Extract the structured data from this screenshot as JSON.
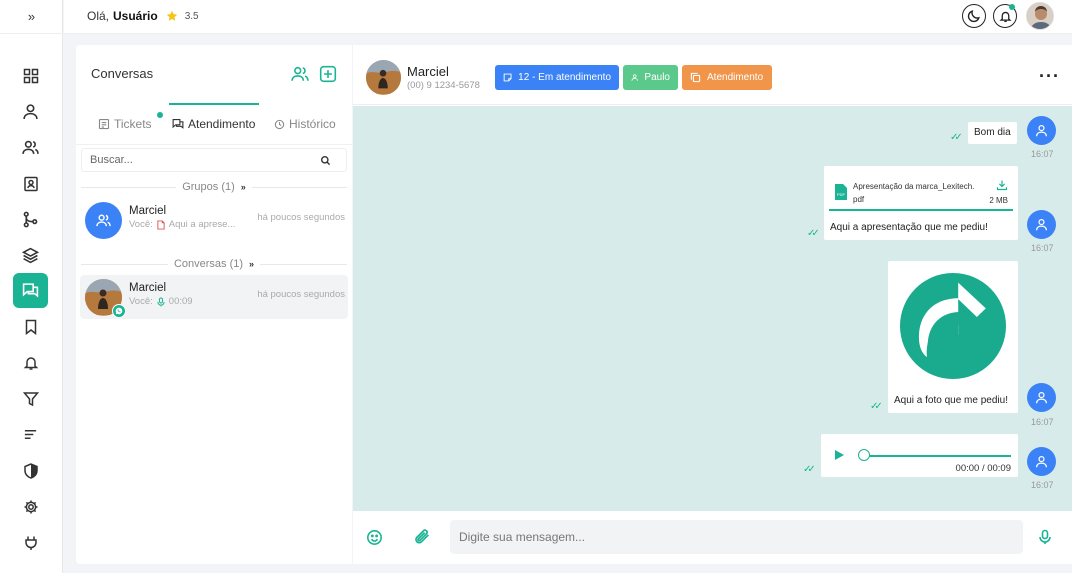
{
  "sidebar": {
    "expand_label": "»",
    "items": [
      {
        "icon": "grid-icon"
      },
      {
        "icon": "user-icon"
      },
      {
        "icon": "users-icon"
      },
      {
        "icon": "contact-card-icon"
      },
      {
        "icon": "git-branch-icon"
      },
      {
        "icon": "layers-icon"
      },
      {
        "icon": "chat-icon",
        "active": true
      },
      {
        "icon": "bookmark-icon"
      },
      {
        "icon": "bell-icon"
      },
      {
        "icon": "filter-icon"
      },
      {
        "icon": "sort-lines-icon"
      },
      {
        "icon": "shield-icon"
      },
      {
        "icon": "gear-icon"
      },
      {
        "icon": "plug-icon"
      }
    ]
  },
  "header": {
    "greeting": "Olá,",
    "user": "Usuário",
    "rating": "3.5"
  },
  "conversations": {
    "title": "Conversas",
    "tabs": [
      {
        "label": "Tickets"
      },
      {
        "label": "Atendimento"
      },
      {
        "label": "Histórico"
      }
    ],
    "search_placeholder": "Buscar...",
    "groups_label": "Grupos (1)",
    "conversations_label": "Conversas (1)",
    "group_item": {
      "name": "Marciel",
      "sender": "Você:",
      "preview": "Aqui a aprese...",
      "time": "há poucos segundos"
    },
    "conv_item": {
      "name": "Marciel",
      "sender": "Você:",
      "preview": "00:09",
      "time": "há poucos segundos"
    }
  },
  "chat": {
    "contact_name": "Marciel",
    "contact_phone": "(00) 9 1234-5678",
    "chips": [
      {
        "label": "12 - Em atendimento",
        "color": "#3b82f6"
      },
      {
        "label": "Paulo",
        "color": "#5cc98c"
      },
      {
        "label": "Atendimento",
        "color": "#f0954a"
      }
    ],
    "messages": [
      {
        "text": "Bom dia",
        "time": "16:07"
      },
      {
        "file_name": "Apresentação da marca_Lexitech.",
        "file_ext": "pdf",
        "file_size": "2 MB",
        "caption": "Aqui a apresentação que me pediu!",
        "time": "16:07"
      },
      {
        "caption": "Aqui a foto que me pediu!",
        "time": "16:07"
      },
      {
        "audio_time": "00:00 / 00:09",
        "time": "16:07"
      }
    ],
    "input_placeholder": "Digite sua mensagem..."
  },
  "colors": {
    "accent": "#1ab394",
    "blue": "#3b82f6",
    "chat_bg": "#d7ecea"
  }
}
